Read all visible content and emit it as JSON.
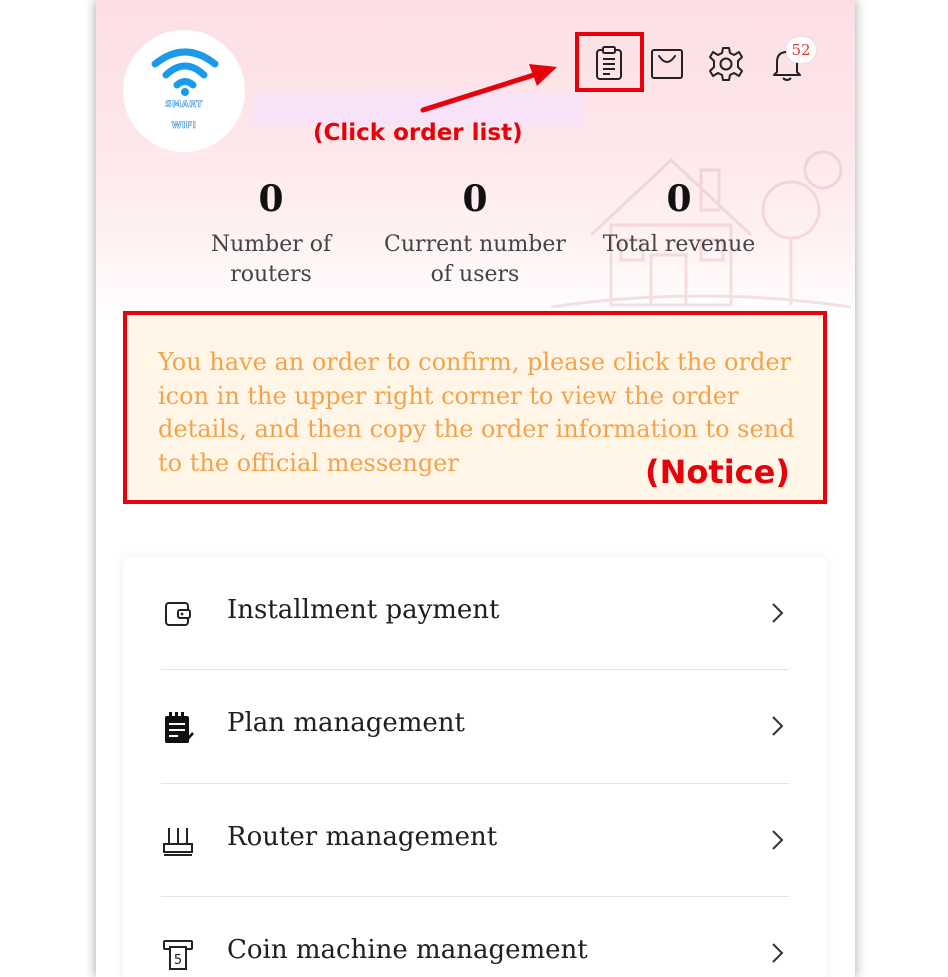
{
  "header": {
    "logo_text_line1": "SMART",
    "logo_text_line2": "WIFI",
    "notification_count": "52",
    "icons": [
      "order-list-icon",
      "shopping-bag-icon",
      "gear-icon",
      "bell-icon"
    ]
  },
  "stats": [
    {
      "value": "0",
      "label": "Number of routers"
    },
    {
      "value": "0",
      "label": "Current number of users"
    },
    {
      "value": "0",
      "label": "Total revenue"
    }
  ],
  "notice": {
    "text": "You have an order to confirm, please click the order icon in the upper right corner to view the order details, and then copy the order information to send to the official messenger"
  },
  "annotations": {
    "click_order_list": "(Click order list)",
    "notice_label": "(Notice)"
  },
  "menu": {
    "items": [
      {
        "label": "Installment payment",
        "icon": "wallet-icon"
      },
      {
        "label": "Plan management",
        "icon": "notepad-check-icon"
      },
      {
        "label": "Router management",
        "icon": "router-icon"
      },
      {
        "label": "Coin machine management",
        "icon": "coin-machine-icon"
      }
    ]
  },
  "colors": {
    "header_gradient_top": "#fcdfe4",
    "notice_bg": "#fff6e8",
    "notice_text": "#f5a24a",
    "annotation_red": "#e8000b",
    "badge_text": "#e53935"
  }
}
